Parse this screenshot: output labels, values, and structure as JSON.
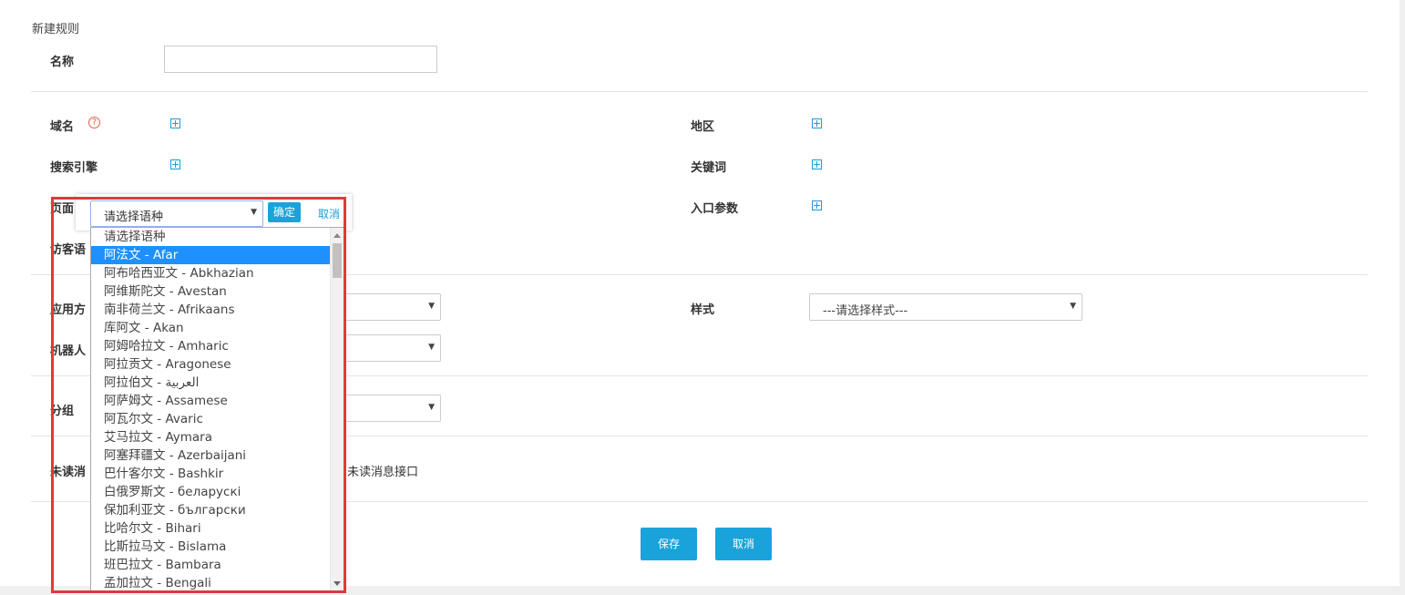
{
  "form": {
    "section_title": "新建规则",
    "name_label": "名称",
    "domain_label": "域名",
    "region_label": "地区",
    "engine_label": "搜索引擎",
    "keyword_label": "关键词",
    "page_label": "页面",
    "entry_label": "入口参数",
    "visitor_lang_label": "访客语",
    "apply_label": "应用方",
    "style_label": "样式",
    "style_value": "---请选择样式---",
    "robot_label": "机器人",
    "group_label": "分组",
    "unread_label": "未读消",
    "unread_text": "用未读消息接口",
    "help_glyph": "?",
    "save_label": "保存",
    "cancel_label": "取消"
  },
  "popup": {
    "select_value": "请选择语种",
    "ok_label": "确定",
    "cancel_label": "取消",
    "options": [
      "请选择语种",
      "阿法文 - Afar",
      "阿布哈西亚文 - Abkhazian",
      "阿维斯陀文 - Avestan",
      "南非荷兰文 - Afrikaans",
      "库阿文 - Akan",
      "阿姆哈拉文 - Amharic",
      "阿拉贡文 - Aragonese",
      "阿拉伯文 - العربية",
      "阿萨姆文 - Assamese",
      "阿瓦尔文 - Avaric",
      "艾马拉文 - Aymara",
      "阿塞拜疆文 - Azerbaijani",
      "巴什客尔文 - Bashkir",
      "白俄罗斯文 - беларускі",
      "保加利亚文 - български",
      "比哈尔文 - Bihari",
      "比斯拉马文 - Bislama",
      "班巴拉文 - Bambara",
      "孟加拉文 - Bengali"
    ],
    "selected_index": 1
  },
  "colors": {
    "accent": "#1aa3db",
    "highlight": "#e03a3a",
    "selection": "#1e90ff"
  }
}
